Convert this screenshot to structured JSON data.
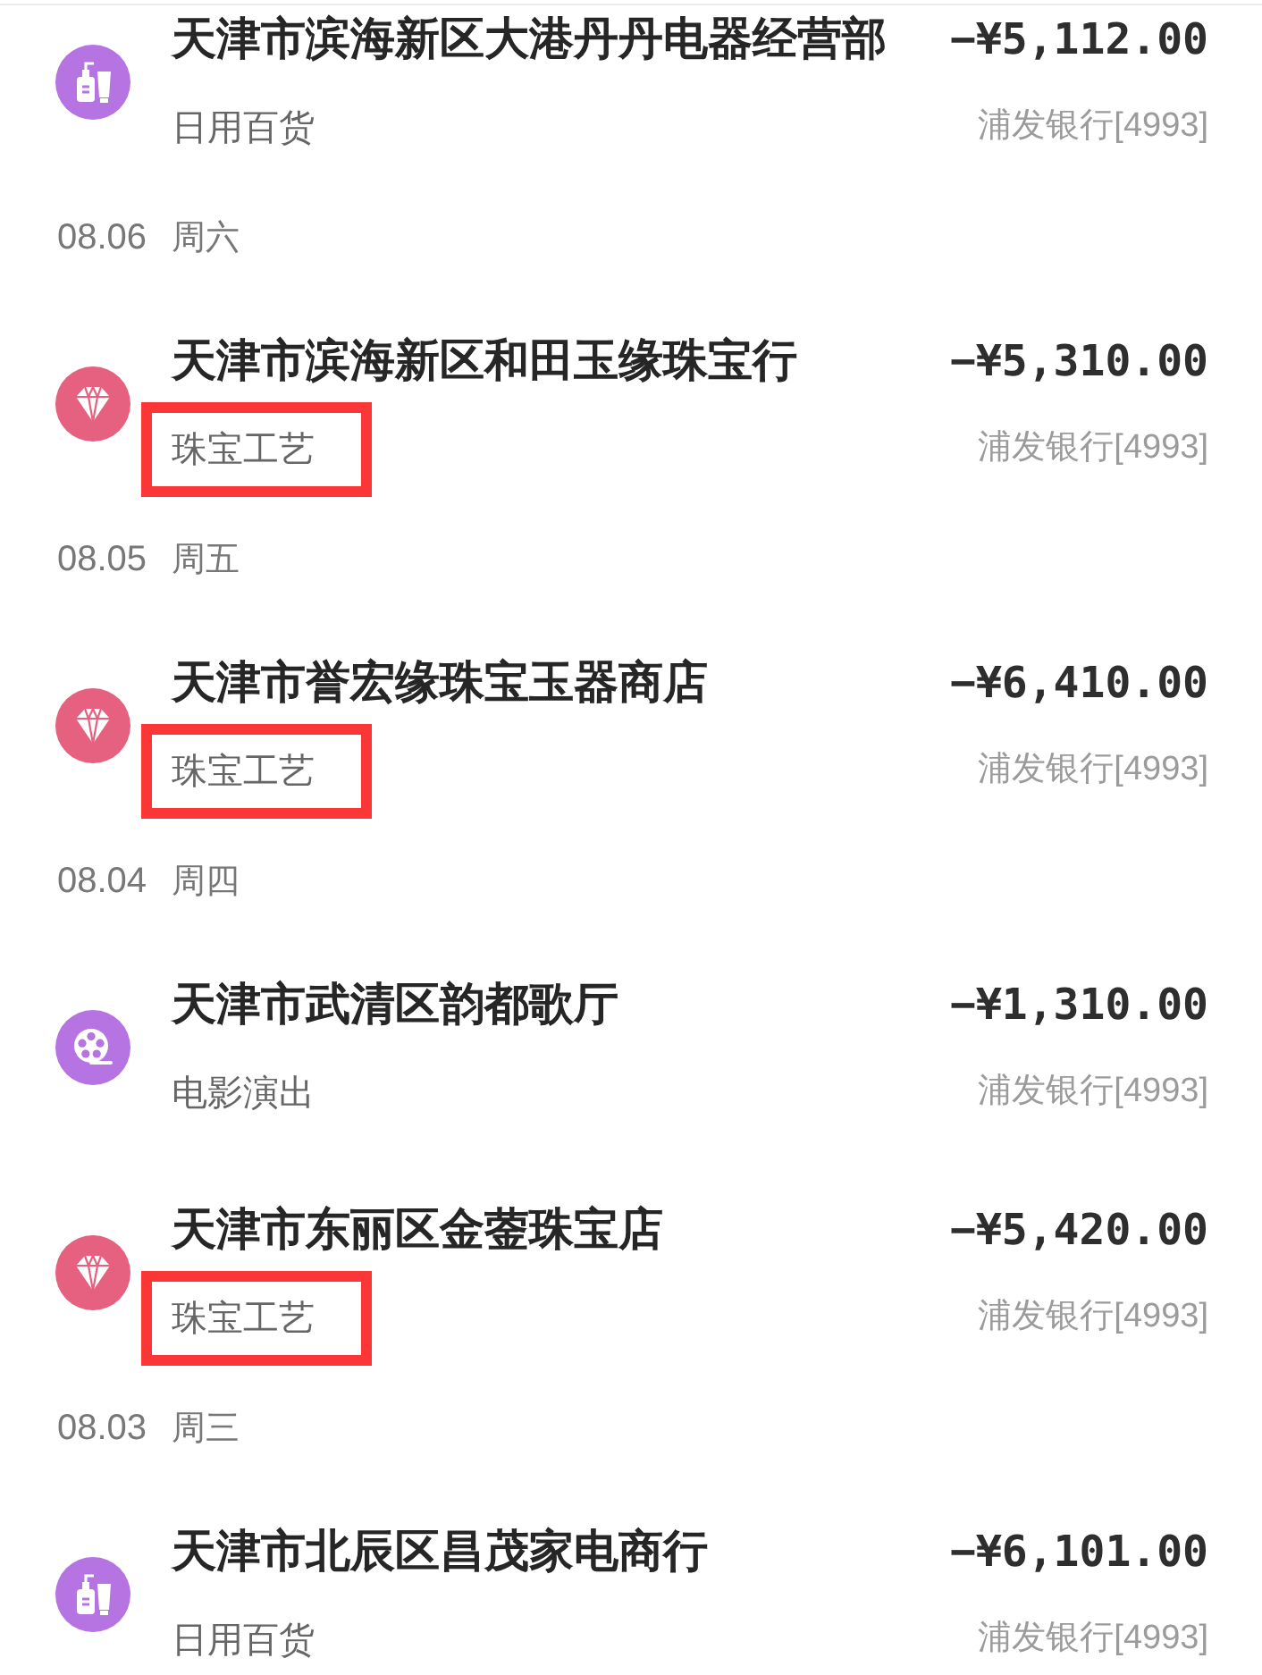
{
  "groups": [
    {
      "transactions": [
        {
          "kind": "toiletries",
          "merchant": "天津市滨海新区大港丹丹电器经营部",
          "amount": "−¥5,112.00",
          "category": "日用百货",
          "highlighted": false,
          "account": "浦发银行[4993]"
        }
      ]
    },
    {
      "date": "08.06",
      "weekday": "周六",
      "transactions": [
        {
          "kind": "jewelry",
          "merchant": "天津市滨海新区和田玉缘珠宝行",
          "amount": "−¥5,310.00",
          "category": "珠宝工艺",
          "highlighted": true,
          "account": "浦发银行[4993]"
        }
      ]
    },
    {
      "date": "08.05",
      "weekday": "周五",
      "transactions": [
        {
          "kind": "jewelry",
          "merchant": "天津市誉宏缘珠宝玉器商店",
          "amount": "−¥6,410.00",
          "category": "珠宝工艺",
          "highlighted": true,
          "account": "浦发银行[4993]"
        }
      ]
    },
    {
      "date": "08.04",
      "weekday": "周四",
      "transactions": [
        {
          "kind": "film",
          "merchant": "天津市武清区韵都歌厅",
          "amount": "−¥1,310.00",
          "category": "电影演出",
          "highlighted": false,
          "account": "浦发银行[4993]"
        },
        {
          "kind": "jewelry",
          "merchant": "天津市东丽区金蓥珠宝店",
          "amount": "−¥5,420.00",
          "category": "珠宝工艺",
          "highlighted": true,
          "account": "浦发银行[4993]"
        }
      ]
    },
    {
      "date": "08.03",
      "weekday": "周三",
      "transactions": [
        {
          "kind": "toiletries",
          "merchant": "天津市北辰区昌茂家电商行",
          "amount": "−¥6,101.00",
          "category": "日用百货",
          "highlighted": false,
          "account": "浦发银行[4993]"
        }
      ]
    }
  ]
}
